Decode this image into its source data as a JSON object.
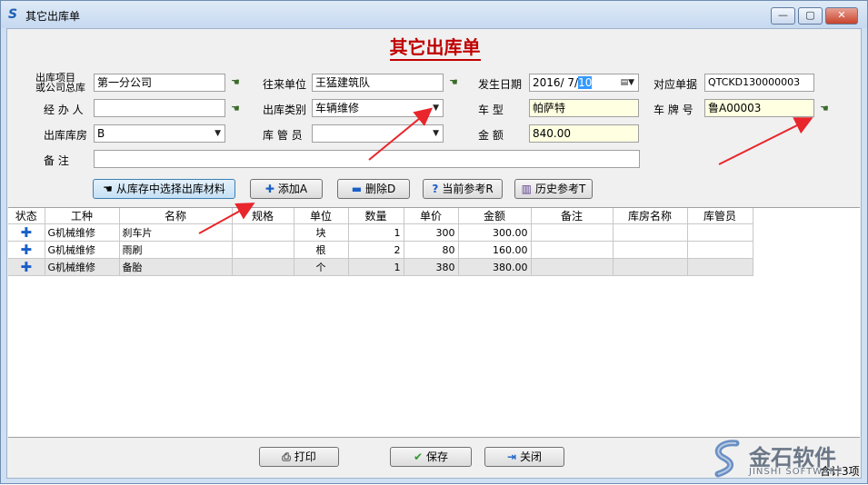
{
  "window": {
    "title": "其它出库单",
    "min_label": "—",
    "max_label": "▢",
    "close_label": "✕"
  },
  "form": {
    "title": "其它出库单",
    "labels": {
      "item_line1": "出库项目",
      "item_line2": "或公司总库",
      "handler": "经 办 人",
      "warehouse": "出库库房",
      "remark": "备    注",
      "partner": "往来单位",
      "category": "出库类别",
      "keeper": "库 管 员",
      "date": "发生日期",
      "car_type": "车    型",
      "amount": "金    额",
      "ref_no": "对应单据",
      "plate": "车 牌 号"
    },
    "values": {
      "item": "第一分公司",
      "handler": "",
      "warehouse": "B",
      "remark": "",
      "partner": "王猛建筑队",
      "category": "车辆维修",
      "keeper": "",
      "date_prefix": "2016/ 7/",
      "date_day": "10",
      "car_type": "帕萨特",
      "amount": "840.00",
      "ref_no": "QTCKD130000003",
      "plate": "鲁A00003"
    }
  },
  "toolbar": {
    "select_from_stock": "从库存中选择出库材料",
    "add": "添加A",
    "delete": "删除D",
    "current_ref": "当前参考R",
    "history_ref": "历史参考T"
  },
  "table": {
    "columns": [
      "状态",
      "工种",
      "名称",
      "规格",
      "单位",
      "数量",
      "单价",
      "金额",
      "备注",
      "库房名称",
      "库管员"
    ],
    "rows": [
      {
        "status": "✚",
        "trade": "G机械维修",
        "name": "刹车片",
        "spec": "",
        "unit": "块",
        "qty": "1",
        "price": "300",
        "amount": "300.00",
        "remark": "",
        "warehouse": "",
        "keeper": ""
      },
      {
        "status": "✚",
        "trade": "G机械维修",
        "name": "雨刷",
        "spec": "",
        "unit": "根",
        "qty": "2",
        "price": "80",
        "amount": "160.00",
        "remark": "",
        "warehouse": "",
        "keeper": ""
      },
      {
        "status": "✚",
        "trade": "G机械维修",
        "name": "备胎",
        "spec": "",
        "unit": "个",
        "qty": "1",
        "price": "380",
        "amount": "380.00",
        "remark": "",
        "warehouse": "",
        "keeper": ""
      }
    ]
  },
  "footer": {
    "print": "打印",
    "save": "保存",
    "close": "关闭",
    "total": "合计3项"
  },
  "logo": {
    "name": "金石软件",
    "sub": "JINSHI SOFTWARE"
  },
  "colors": {
    "title_red": "#c00000",
    "highlight_yellow": "#ffffe1",
    "arrow_red": "#e8262b"
  }
}
